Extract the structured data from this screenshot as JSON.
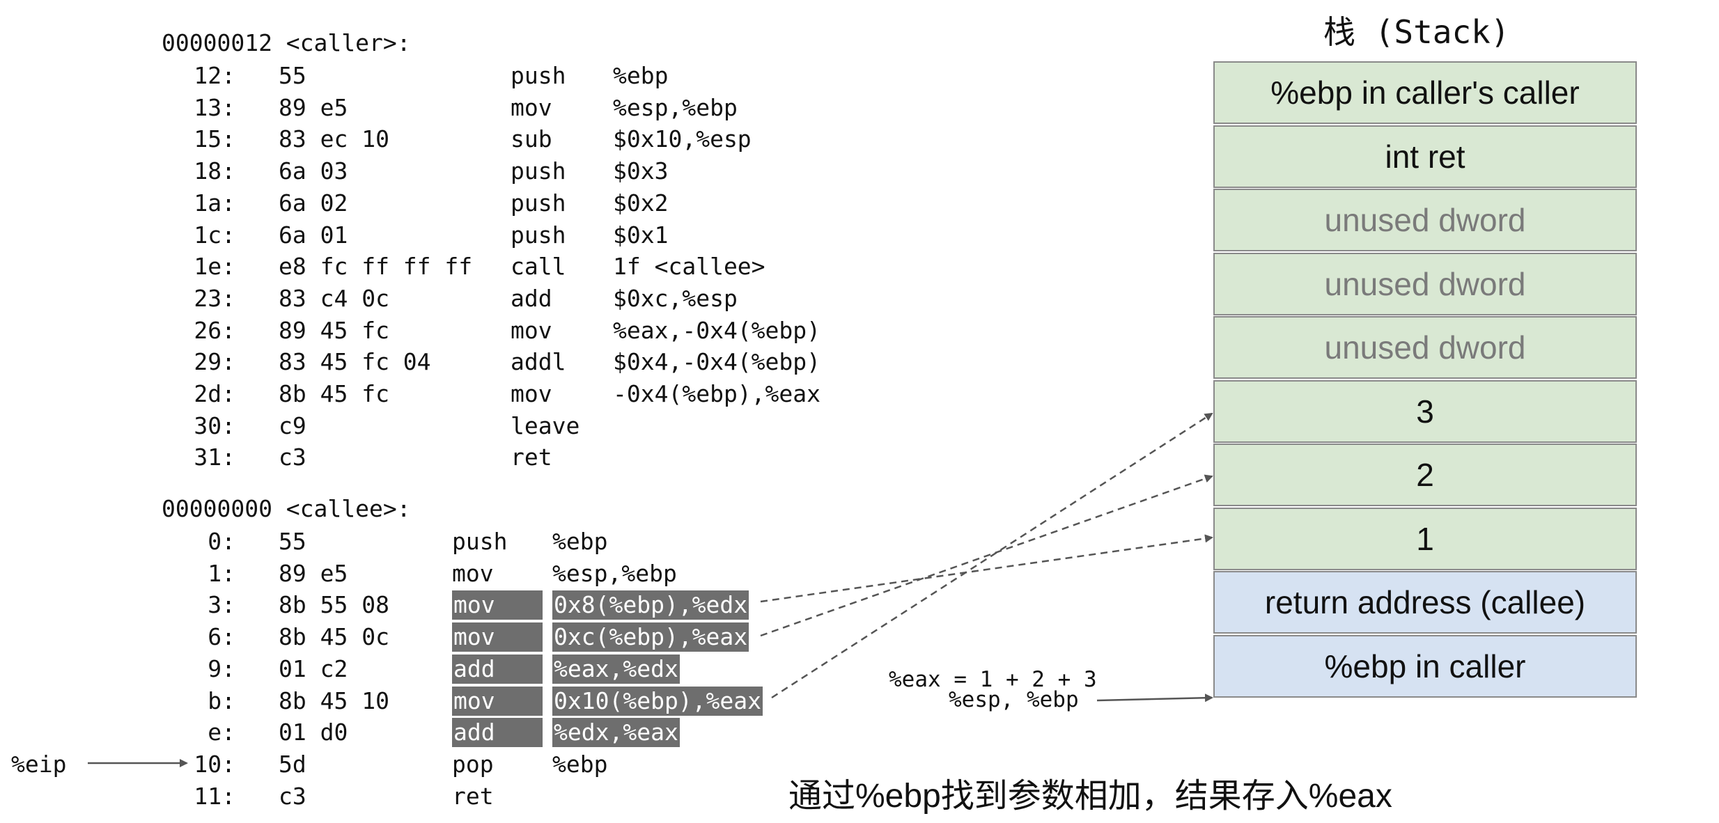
{
  "caller": {
    "header": "00000012 <caller>:",
    "rows": [
      {
        "addr": "12:",
        "bytes": "55",
        "op": "push",
        "args": "%ebp"
      },
      {
        "addr": "13:",
        "bytes": "89 e5",
        "op": "mov",
        "args": "%esp,%ebp"
      },
      {
        "addr": "15:",
        "bytes": "83 ec 10",
        "op": "sub",
        "args": "$0x10,%esp"
      },
      {
        "addr": "18:",
        "bytes": "6a 03",
        "op": "push",
        "args": "$0x3"
      },
      {
        "addr": "1a:",
        "bytes": "6a 02",
        "op": "push",
        "args": "$0x2"
      },
      {
        "addr": "1c:",
        "bytes": "6a 01",
        "op": "push",
        "args": "$0x1"
      },
      {
        "addr": "1e:",
        "bytes": "e8 fc ff ff ff",
        "op": "call",
        "args": "1f <callee>"
      },
      {
        "addr": "23:",
        "bytes": "83 c4 0c",
        "op": "add",
        "args": "$0xc,%esp"
      },
      {
        "addr": "26:",
        "bytes": "89 45 fc",
        "op": "mov",
        "args": "%eax,-0x4(%ebp)"
      },
      {
        "addr": "29:",
        "bytes": "83 45 fc 04",
        "op": "addl",
        "args": "$0x4,-0x4(%ebp)"
      },
      {
        "addr": "2d:",
        "bytes": "8b 45 fc",
        "op": "mov",
        "args": "-0x4(%ebp),%eax"
      },
      {
        "addr": "30:",
        "bytes": "c9",
        "op": "leave",
        "args": ""
      },
      {
        "addr": "31:",
        "bytes": "c3",
        "op": "ret",
        "args": ""
      }
    ]
  },
  "callee": {
    "header": "00000000 <callee>:",
    "rows": [
      {
        "addr": "0:",
        "bytes": "55",
        "op": "push",
        "args": "%ebp",
        "hl": false
      },
      {
        "addr": "1:",
        "bytes": "89 e5",
        "op": "mov",
        "args": "%esp,%ebp",
        "hl": false
      },
      {
        "addr": "3:",
        "bytes": "8b 55 08",
        "op": "mov",
        "args": "0x8(%ebp),%edx",
        "hl": true
      },
      {
        "addr": "6:",
        "bytes": "8b 45 0c",
        "op": "mov",
        "args": "0xc(%ebp),%eax",
        "hl": true
      },
      {
        "addr": "9:",
        "bytes": "01 c2",
        "op": "add",
        "args": "%eax,%edx",
        "hl": true
      },
      {
        "addr": "b:",
        "bytes": "8b 45 10",
        "op": "mov",
        "args": "0x10(%ebp),%eax",
        "hl": true
      },
      {
        "addr": "e:",
        "bytes": "01 d0",
        "op": "add",
        "args": "%edx,%eax",
        "hl": true
      },
      {
        "addr": "10:",
        "bytes": "5d",
        "op": "pop",
        "args": "%ebp",
        "hl": false
      },
      {
        "addr": "11:",
        "bytes": "c3",
        "op": "ret",
        "args": "",
        "hl": false
      }
    ]
  },
  "eip_label": "%eip",
  "stack": {
    "title": "栈 (Stack)",
    "cells": [
      {
        "label": "%ebp in caller's caller",
        "color": "green",
        "dim": false
      },
      {
        "label": "int ret",
        "color": "green",
        "dim": false
      },
      {
        "label": "unused dword",
        "color": "green",
        "dim": true
      },
      {
        "label": "unused dword",
        "color": "green",
        "dim": true
      },
      {
        "label": "unused dword",
        "color": "green",
        "dim": true
      },
      {
        "label": "3",
        "color": "green",
        "dim": false
      },
      {
        "label": "2",
        "color": "green",
        "dim": false
      },
      {
        "label": "1",
        "color": "green",
        "dim": false
      },
      {
        "label": "return address (callee)",
        "color": "blue",
        "dim": false
      },
      {
        "label": "%ebp in caller",
        "color": "blue",
        "dim": false
      }
    ]
  },
  "eax_note": "%eax = 1 + 2 + 3",
  "esp_ebp_label": "%esp, %ebp",
  "caption": "通过%ebp找到参数相加，结果存入%eax"
}
